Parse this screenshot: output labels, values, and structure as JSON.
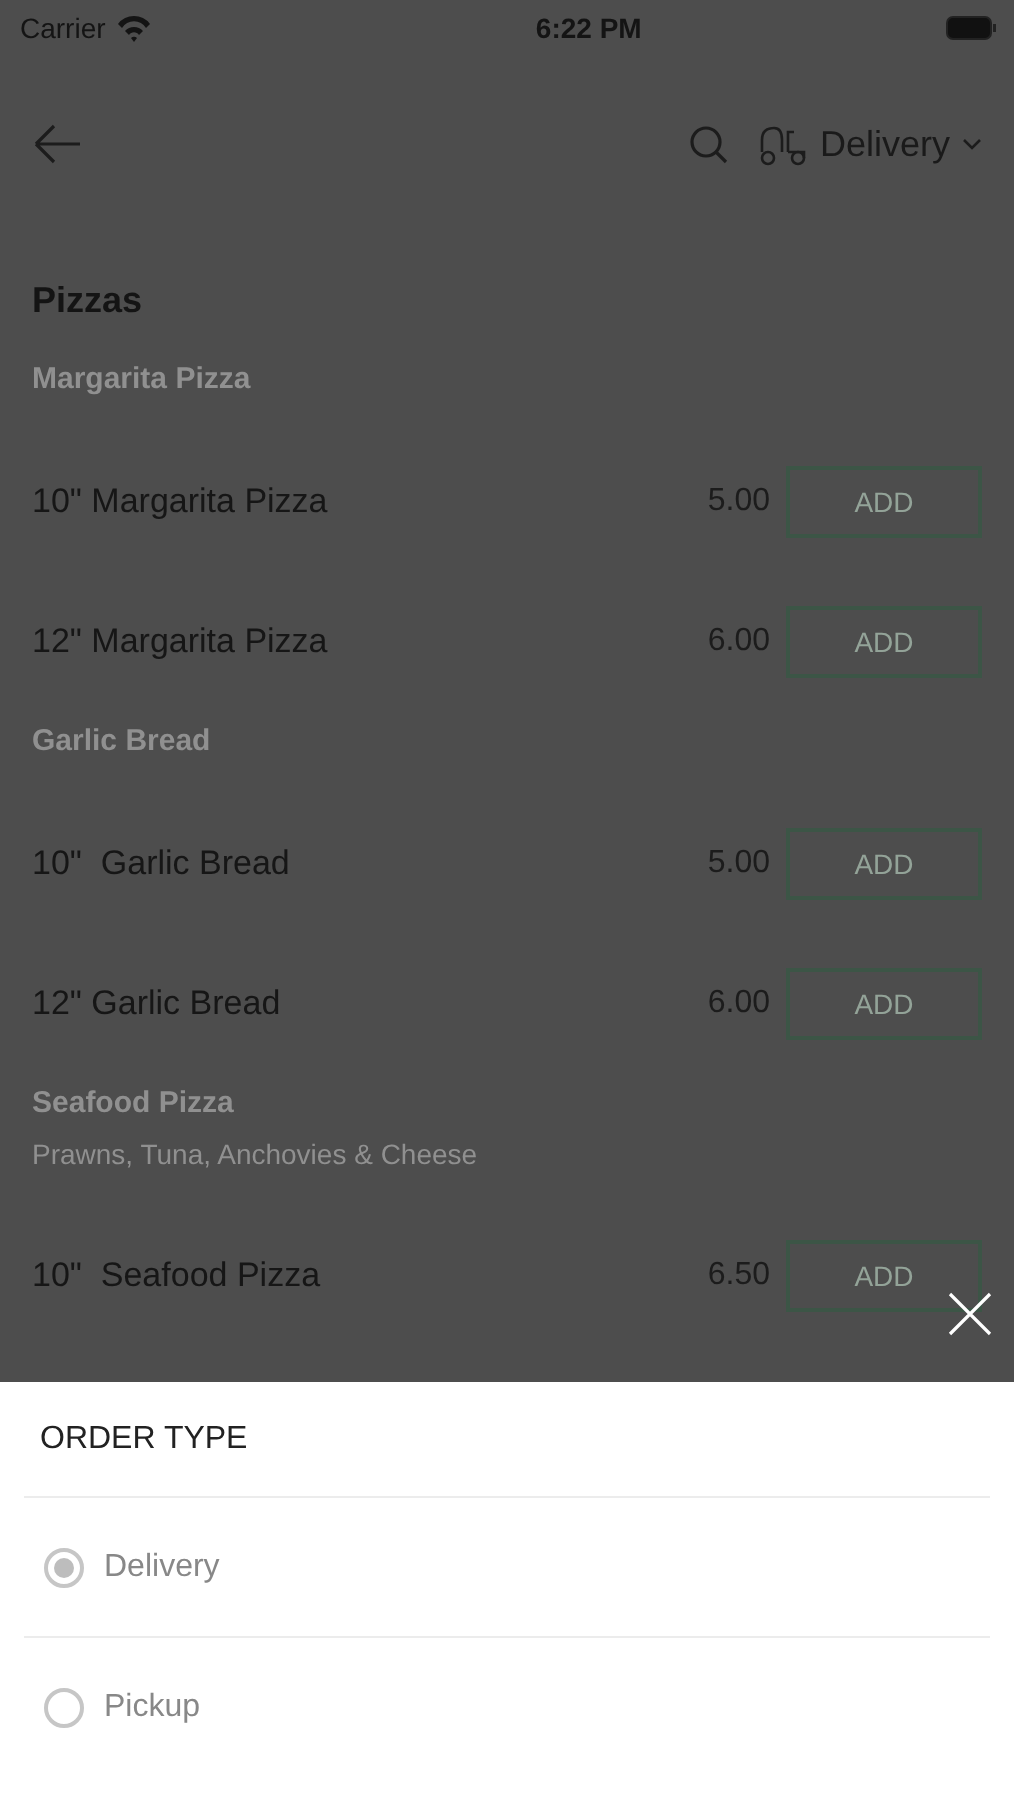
{
  "status_bar": {
    "carrier": "Carrier",
    "time": "6:22 PM"
  },
  "header": {
    "order_type": "Delivery"
  },
  "menu": {
    "title": "Pizzas",
    "groups": [
      {
        "name": "Margarita Pizza",
        "items": [
          {
            "name": "10\" Margarita Pizza",
            "price": "5.00",
            "button": "ADD"
          },
          {
            "name": "12\" Margarita Pizza",
            "price": "6.00",
            "button": "ADD"
          }
        ]
      },
      {
        "name": "Garlic Bread",
        "items": [
          {
            "name": "10\"  Garlic Bread",
            "price": "5.00",
            "button": "ADD"
          },
          {
            "name": "12\" Garlic Bread",
            "price": "6.00",
            "button": "ADD"
          }
        ]
      },
      {
        "name": "Seafood Pizza",
        "description": "Prawns, Tuna, Anchovies & Cheese",
        "items": [
          {
            "name": "10\"  Seafood Pizza",
            "price": "6.50",
            "button": "ADD"
          }
        ]
      }
    ]
  },
  "sheet": {
    "title": "ORDER TYPE",
    "options": [
      {
        "label": "Delivery",
        "selected": true
      },
      {
        "label": "Pickup",
        "selected": false
      }
    ]
  }
}
